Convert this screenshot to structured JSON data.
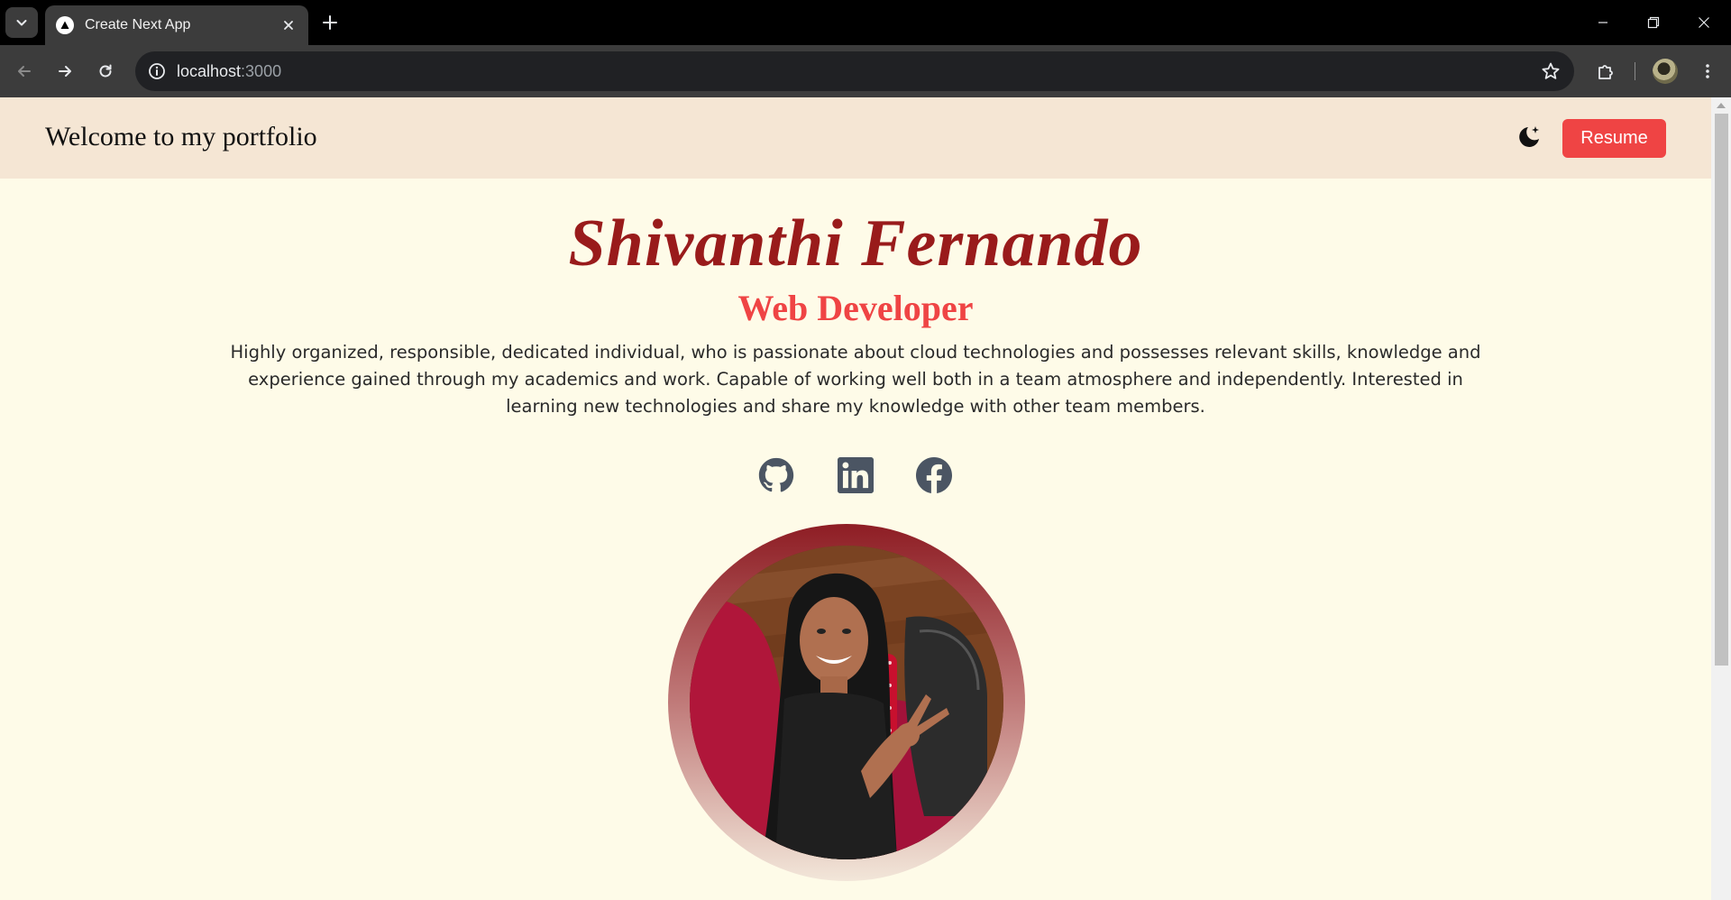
{
  "browser": {
    "tab_title": "Create Next App",
    "url_host": "localhost",
    "url_port": ":3000"
  },
  "header": {
    "title": "Welcome to my portfolio",
    "resume_label": "Resume",
    "accent_color": "#ef4444"
  },
  "hero": {
    "name": "Shivanthi Fernando",
    "role": "Web Developer",
    "bio": "Highly organized, responsible, dedicated individual, who is passionate about cloud technologies and possesses relevant skills, knowledge and experience gained through my academics and work. Capable of working well both in a team atmosphere and independently. Interested in learning new technologies and share my knowledge with other team members.",
    "name_color": "#991b1b"
  },
  "socials": [
    {
      "icon": "github-icon"
    },
    {
      "icon": "linkedin-icon"
    },
    {
      "icon": "facebook-icon"
    }
  ]
}
